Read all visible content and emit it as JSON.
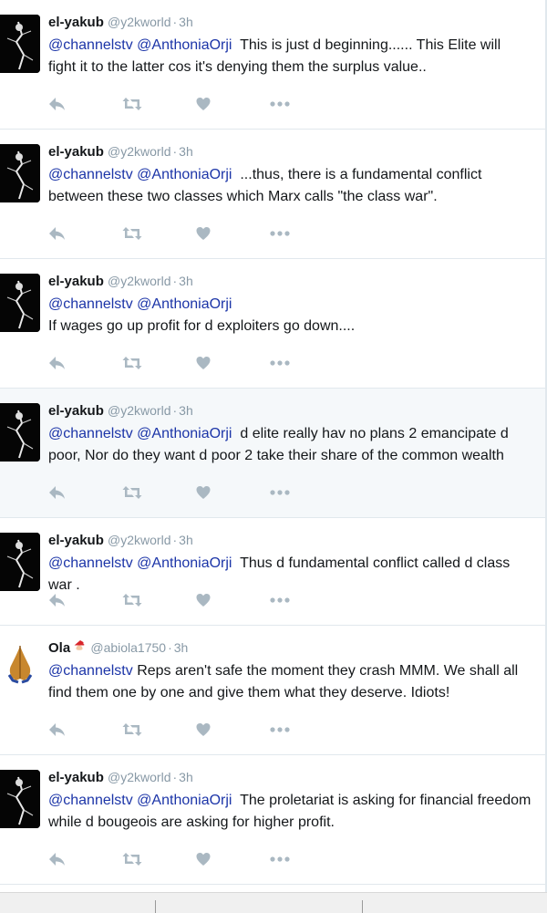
{
  "tweets": [
    {
      "name": "el-yakub",
      "handle": "@y2kworld",
      "time": "3h",
      "mentions": "@channelstv @AnthoniaOrji",
      "text": "This is just d beginning...... This Elite will fight it to the latter cos it's denying them the surplus value.."
    },
    {
      "name": "el-yakub",
      "handle": "@y2kworld",
      "time": "3h",
      "mentions": "@channelstv @AnthoniaOrji",
      "text": "...thus, there is a fundamental conflict between these two classes which Marx calls \"the class war\"."
    },
    {
      "name": "el-yakub",
      "handle": "@y2kworld",
      "time": "3h",
      "mentions": "@channelstv @AnthoniaOrji",
      "text": "If wages go up profit for d exploiters go down...."
    },
    {
      "name": "el-yakub",
      "handle": "@y2kworld",
      "time": "3h",
      "mentions": "@channelstv @AnthoniaOrji",
      "text": "d elite really hav no plans 2 emancipate d poor, Nor do they want d poor 2 take their share of the common wealth"
    },
    {
      "name": "el-yakub",
      "handle": "@y2kworld",
      "time": "3h",
      "mentions": "@channelstv @AnthoniaOrji",
      "text": "Thus d fundamental conflict called d class war ."
    },
    {
      "name": "Ola",
      "handle": "@abiola1750",
      "time": "3h",
      "mentions": "@channelstv",
      "text": "Reps aren't safe the moment they crash MMM. We shall all find them one by one and give them what they deserve. Idiots!"
    },
    {
      "name": "el-yakub",
      "handle": "@y2kworld",
      "time": "3h",
      "mentions": "@channelstv @AnthoniaOrji",
      "text": "The proletariat is asking for financial freedom while d bougeois are asking for higher profit."
    }
  ],
  "action_icons": [
    "reply-icon",
    "retweet-icon",
    "like-icon",
    "more-icon"
  ],
  "colors": {
    "mention": "#1c35a8",
    "icon": "#aab8c2",
    "secondary": "#8899a6",
    "highlight_bg": "#f5f8fa"
  }
}
